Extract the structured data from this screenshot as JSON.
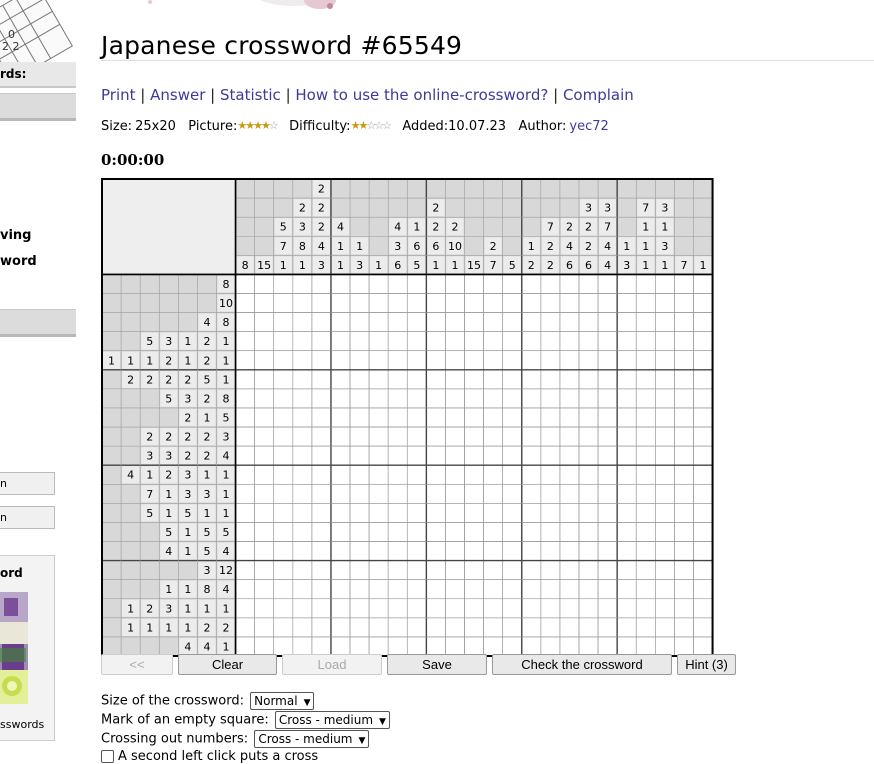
{
  "sidebar": {
    "header": "rds:",
    "links": [
      "ving",
      "word"
    ],
    "buttons": [
      "n",
      "n"
    ],
    "card_title": "ord",
    "card_bottom": "sswords"
  },
  "title": "Japanese crossword #65549",
  "links": {
    "print": "Print",
    "answer": "Answer",
    "statistic": "Statistic",
    "howto": "How to use the online-crossword?",
    "complain": "Complain",
    "separator": "|"
  },
  "info": {
    "size_label": "Size:",
    "size": "25x20",
    "picture_label": "Picture:",
    "picture_rating": 4,
    "difficulty_label": "Difficulty:",
    "difficulty_rating": 2,
    "added_label": "Added:",
    "added": "10.07.23",
    "author_label": "Author:",
    "author": "yec72",
    "rating_max": 5
  },
  "timer": "0:00:00",
  "puzzle": {
    "cols": 25,
    "rows": 20,
    "column_clues": [
      [
        8
      ],
      [
        15
      ],
      [
        5,
        7,
        1
      ],
      [
        2,
        3,
        8,
        1
      ],
      [
        2,
        2,
        2,
        4,
        3
      ],
      [
        4,
        1,
        1
      ],
      [
        1,
        3
      ],
      [
        1
      ],
      [
        4,
        3,
        6
      ],
      [
        1,
        6,
        5
      ],
      [
        2,
        2,
        6,
        1
      ],
      [
        2,
        10,
        1
      ],
      [
        15
      ],
      [
        2,
        7
      ],
      [
        5
      ],
      [
        1,
        2
      ],
      [
        7,
        2,
        2
      ],
      [
        2,
        4,
        6
      ],
      [
        3,
        2,
        2,
        6
      ],
      [
        3,
        7,
        4,
        4
      ],
      [
        1,
        3
      ],
      [
        7,
        1,
        1,
        1
      ],
      [
        3,
        1,
        3,
        1
      ],
      [
        7
      ],
      [
        1
      ]
    ],
    "row_clues": [
      [
        8
      ],
      [
        10
      ],
      [
        4,
        8
      ],
      [
        5,
        3,
        1,
        2,
        1
      ],
      [
        1,
        1,
        1,
        2,
        1,
        2,
        1
      ],
      [
        2,
        2,
        2,
        2,
        5,
        1
      ],
      [
        5,
        3,
        2,
        8
      ],
      [
        2,
        1,
        5
      ],
      [
        2,
        2,
        2,
        2,
        3
      ],
      [
        3,
        3,
        2,
        2,
        4
      ],
      [
        4,
        1,
        2,
        3,
        1,
        1
      ],
      [
        7,
        1,
        3,
        3,
        1
      ],
      [
        5,
        1,
        5,
        1,
        1
      ],
      [
        5,
        1,
        5,
        5
      ],
      [
        4,
        1,
        5,
        4
      ],
      [
        3,
        12
      ],
      [
        1,
        1,
        8,
        4
      ],
      [
        1,
        2,
        3,
        1,
        1,
        1
      ],
      [
        1,
        1,
        1,
        1,
        2,
        2
      ],
      [
        4,
        4,
        1
      ]
    ]
  },
  "buttons": {
    "prev": "<<",
    "clear": "Clear",
    "load": "Load",
    "save": "Save",
    "check": "Check the crossword",
    "hint": "Hint (3)"
  },
  "options": {
    "size_label": "Size of the crossword:",
    "size_value": "Normal",
    "empty_label": "Mark of an empty square:",
    "empty_value": "Cross - medium",
    "crossing_label": "Crossing out numbers:",
    "crossing_value": "Cross - medium",
    "second_click_label": "A second left click puts a cross"
  },
  "colors": {
    "link": "#3b3b9b",
    "clue_bg": "#d8d8d8",
    "corner_bg": "#eeeeee",
    "star": "#c89a10"
  }
}
